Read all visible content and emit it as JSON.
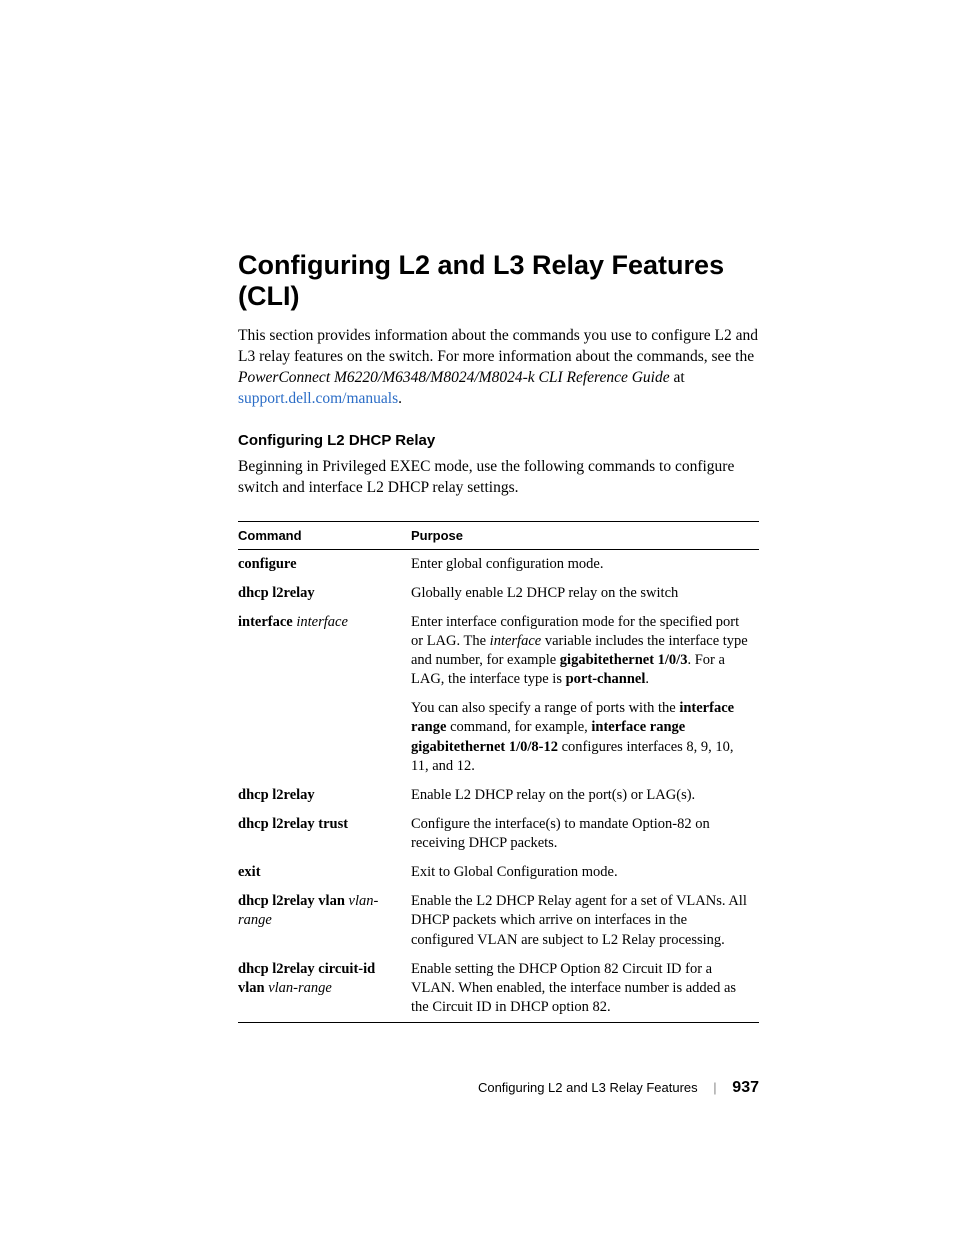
{
  "title": "Configuring L2 and L3 Relay Features (CLI)",
  "intro": {
    "pre": "This section provides information about the commands you use to configure L2 and L3 relay features on the switch. For more information about the commands, see the ",
    "ref": "PowerConnect M6220/M6348/M8024/M8024-k CLI Reference Guide",
    "at": " at ",
    "link": "support.dell.com/manuals",
    "post": "."
  },
  "section": {
    "heading": "Configuring L2 DHCP Relay",
    "lead": "Beginning in Privileged EXEC mode, use the following commands to configure switch and interface L2 DHCP relay settings."
  },
  "table": {
    "col1": "Command",
    "col2": "Purpose",
    "rows": [
      {
        "cmd_parts": [
          {
            "t": "configure",
            "b": true
          }
        ],
        "purpose_parts": [
          {
            "t": "Enter global configuration mode."
          }
        ]
      },
      {
        "cmd_parts": [
          {
            "t": "dhcp l2relay",
            "b": true
          }
        ],
        "purpose_parts": [
          {
            "t": "Globally enable L2 DHCP relay on the switch"
          }
        ]
      },
      {
        "cmd_parts": [
          {
            "t": "interface ",
            "b": true
          },
          {
            "t": "interface",
            "i": true
          }
        ],
        "purpose_parts": [
          {
            "t": "Enter interface configuration mode for the specified port or LAG. The "
          },
          {
            "t": "interface",
            "i": true
          },
          {
            "t": " variable includes the interface type and number, for example "
          },
          {
            "t": "gigabitethernet 1/0/3",
            "b": true
          },
          {
            "t": ". For a LAG, the interface type is "
          },
          {
            "t": "port-channel",
            "b": true
          },
          {
            "t": "."
          }
        ]
      },
      {
        "cmd_parts": [],
        "purpose_parts": [
          {
            "t": "You can also specify a range of ports with the "
          },
          {
            "t": "interface range",
            "b": true
          },
          {
            "t": " command, for example, "
          },
          {
            "t": "interface range gigabitethernet 1/0/8-12",
            "b": true
          },
          {
            "t": " configures interfaces 8, 9, 10, 11, and 12."
          }
        ]
      },
      {
        "cmd_parts": [
          {
            "t": "dhcp l2relay",
            "b": true
          }
        ],
        "purpose_parts": [
          {
            "t": "Enable L2 DHCP relay on the port(s) or LAG(s)."
          }
        ]
      },
      {
        "cmd_parts": [
          {
            "t": "dhcp l2relay trust",
            "b": true
          }
        ],
        "purpose_parts": [
          {
            "t": "Configure the interface(s) to mandate Option-82 on receiving DHCP packets."
          }
        ]
      },
      {
        "cmd_parts": [
          {
            "t": "exit",
            "b": true
          }
        ],
        "purpose_parts": [
          {
            "t": "Exit to Global Configuration mode."
          }
        ]
      },
      {
        "cmd_parts": [
          {
            "t": "dhcp l2relay vlan ",
            "b": true
          },
          {
            "t": "vlan-range",
            "i": true
          }
        ],
        "purpose_parts": [
          {
            "t": "Enable the L2 DHCP Relay agent for a set of VLANs. All DHCP packets which arrive on interfaces in the configured VLAN are subject to L2 Relay processing."
          }
        ]
      },
      {
        "cmd_parts": [
          {
            "t": "dhcp l2relay circuit-id vlan ",
            "b": true
          },
          {
            "t": "vlan-range",
            "i": true
          }
        ],
        "purpose_parts": [
          {
            "t": "Enable setting the DHCP Option 82 Circuit ID for a VLAN. When enabled, the interface number is added as the Circuit ID in DHCP option 82."
          }
        ]
      }
    ]
  },
  "footer": {
    "title": "Configuring L2 and L3 Relay Features",
    "page": "937"
  }
}
